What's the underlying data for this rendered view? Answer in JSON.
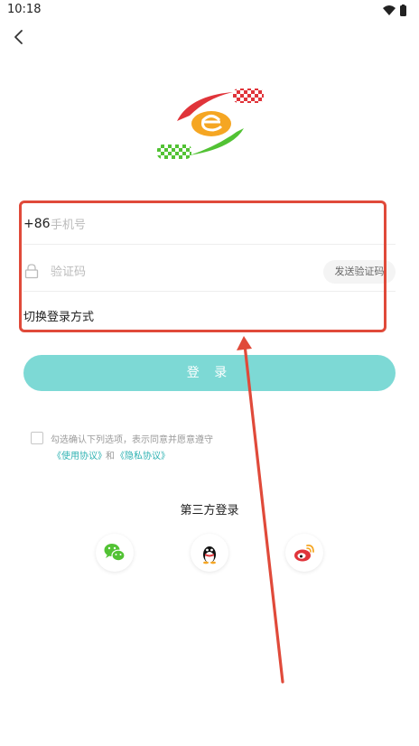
{
  "status_bar": {
    "time": "10:18"
  },
  "form": {
    "country_code": "+86",
    "phone_placeholder": "手机号",
    "code_placeholder": "验证码",
    "send_code_label": "发送验证码",
    "switch_login_label": "切换登录方式"
  },
  "login_label": "登 录",
  "agreement": {
    "text": "勾选确认下列选项，表示同意并愿意遵守",
    "terms_link": "《使用协议》",
    "and": "和",
    "privacy_link": "《隐私协议》"
  },
  "third_party": {
    "title": "第三方登录",
    "providers": [
      "wechat-icon",
      "qq-icon",
      "weibo-icon"
    ]
  },
  "colors": {
    "accent": "#7dd9d5",
    "link": "#2eb2b2",
    "highlight": "#e04a3a"
  }
}
